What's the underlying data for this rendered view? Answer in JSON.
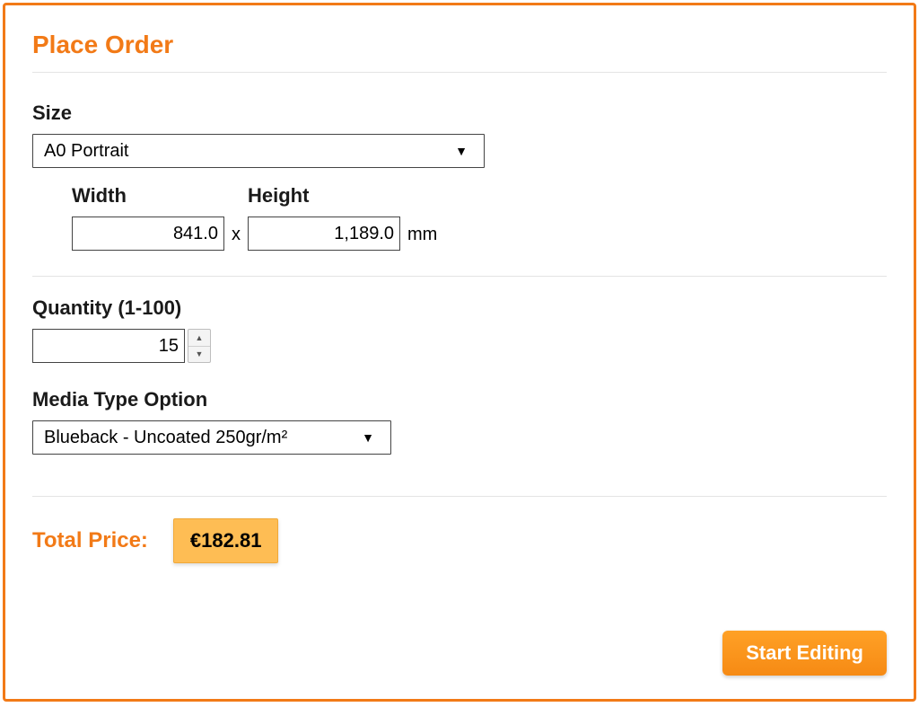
{
  "panel": {
    "title": "Place Order"
  },
  "size": {
    "label": "Size",
    "selected": "A0 Portrait",
    "width_label": "Width",
    "height_label": "Height",
    "width_value": "841.0",
    "height_value": "1,189.0",
    "separator": "x",
    "unit": "mm"
  },
  "quantity": {
    "label": "Quantity (1-100)",
    "value": "15"
  },
  "media": {
    "label": "Media Type Option",
    "selected": "Blueback - Uncoated 250gr/m²"
  },
  "total": {
    "label": "Total Price:",
    "value": "€182.81"
  },
  "actions": {
    "start_editing": "Start Editing"
  }
}
